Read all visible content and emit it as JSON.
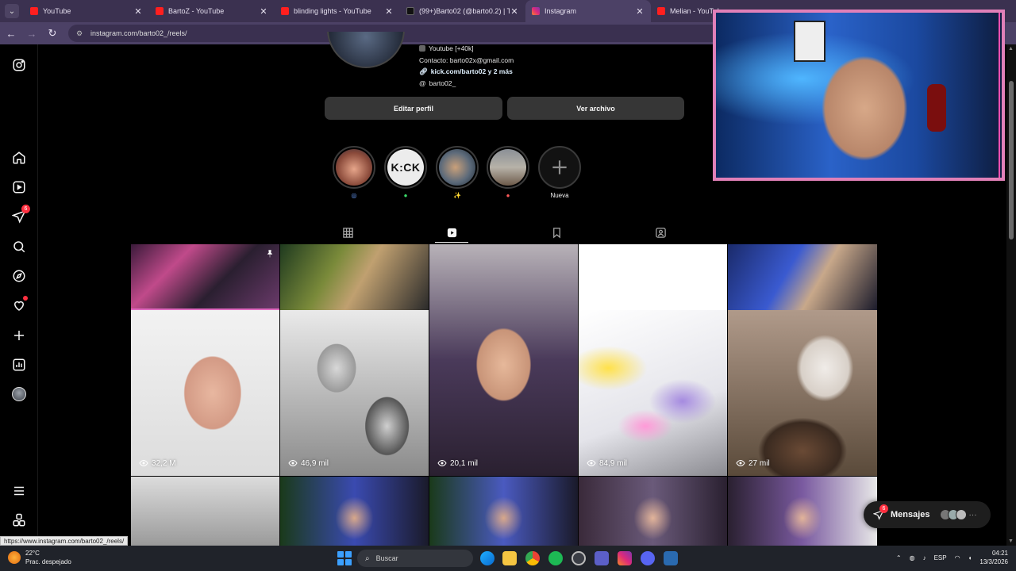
{
  "browser": {
    "tabs": [
      {
        "title": "YouTube",
        "favicon": "youtube-favicon"
      },
      {
        "title": "BartoZ - YouTube",
        "favicon": "youtube-favicon"
      },
      {
        "title": "blinding lights - YouTube",
        "favicon": "youtube-favicon"
      },
      {
        "title": "(99+)Barto02 (@barto0.2) | TikT",
        "favicon": "tiktok-favicon"
      },
      {
        "title": "Instagram",
        "favicon": "instagram-favicon",
        "active": true
      },
      {
        "title": "Melian - YouTub",
        "favicon": "youtube-favicon"
      }
    ],
    "address": "instagram.com/barto02_/reels/",
    "status_url": "https://www.instagram.com/barto02_/reels/"
  },
  "nav": {
    "notifications_badge": "6"
  },
  "profile": {
    "bio_line1": "Youtube [+40k]",
    "bio_contact": "Contacto: barto02x@gmail.com",
    "bio_link": "kick.com/barto02 y 2 más",
    "bio_threads": "barto02_",
    "edit_button": "Editar perfil",
    "archive_button": "Ver archivo"
  },
  "highlights": [
    {
      "label": "◎"
    },
    {
      "label": "●",
      "text": "K:CK"
    },
    {
      "label": "✨"
    },
    {
      "label": "●"
    },
    {
      "label": "Nueva"
    }
  ],
  "reels": [
    {
      "views": "32,2 M"
    },
    {
      "views": "46,9 mil"
    },
    {
      "views": "20,1 mil"
    },
    {
      "views": "84,9 mil"
    },
    {
      "views": "27 mil"
    }
  ],
  "messages": {
    "label": "Mensajes",
    "badge": "6"
  },
  "taskbar": {
    "temperature": "22°C",
    "weather": "Prac. despejado",
    "search_placeholder": "Buscar",
    "language": "ESP",
    "time": "04:21",
    "date": "13/3/2026"
  },
  "colors": {
    "accent_pink": "#e080b8",
    "badge_red": "#ff3040",
    "tabstrip": "#3b3150"
  }
}
